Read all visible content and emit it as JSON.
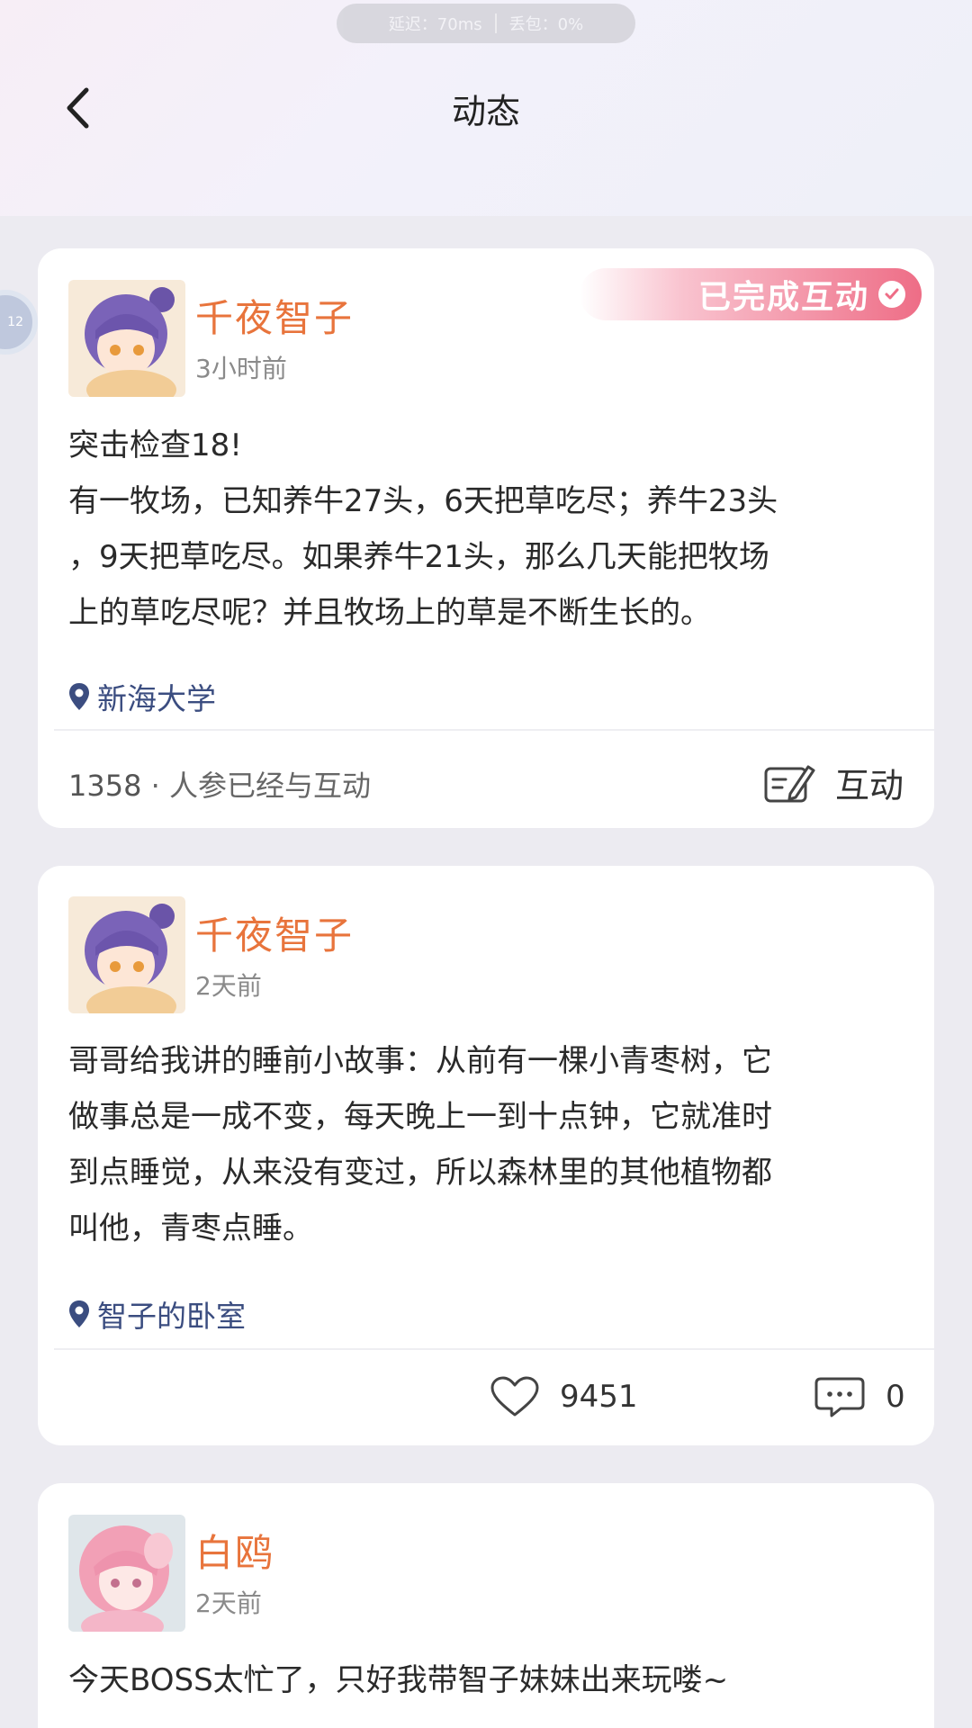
{
  "status_pill": {
    "signal": "延迟：70ms",
    "packet": "丢包：0%"
  },
  "header": {
    "title": "动态"
  },
  "side_bubble": {
    "label": "12"
  },
  "posts": [
    {
      "author": "千夜智子",
      "time": "3小时前",
      "badge": "已完成互动",
      "content": "突击检查18!\n有一牧场，已知养牛27头，6天把草吃尽；养牛23头\n，9天把草吃尽。如果养牛21头，那么几天能把牧场\n上的草吃尽呢？并且牧场上的草是不断生长的。",
      "location": "新海大学",
      "participants_count": "1358",
      "participants_text": "· 人参已经与互动",
      "interact_label": "互动"
    },
    {
      "author": "千夜智子",
      "time": "2天前",
      "content": "哥哥给我讲的睡前小故事：从前有一棵小青枣树，它\n做事总是一成不变，每天晚上一到十点钟，它就准时\n到点睡觉，从来没有变过，所以森林里的其他植物都\n叫他，青枣点睡。",
      "location": "智子的卧室",
      "likes": "9451",
      "comments": "0"
    },
    {
      "author": "白鸥",
      "time": "2天前",
      "content": "今天BOSS太忙了，只好我带智子妹妹出来玩喽~"
    }
  ],
  "colors": {
    "author": "#e8743c",
    "location": "#3b4d80",
    "badge_end": "#ee6d86"
  }
}
